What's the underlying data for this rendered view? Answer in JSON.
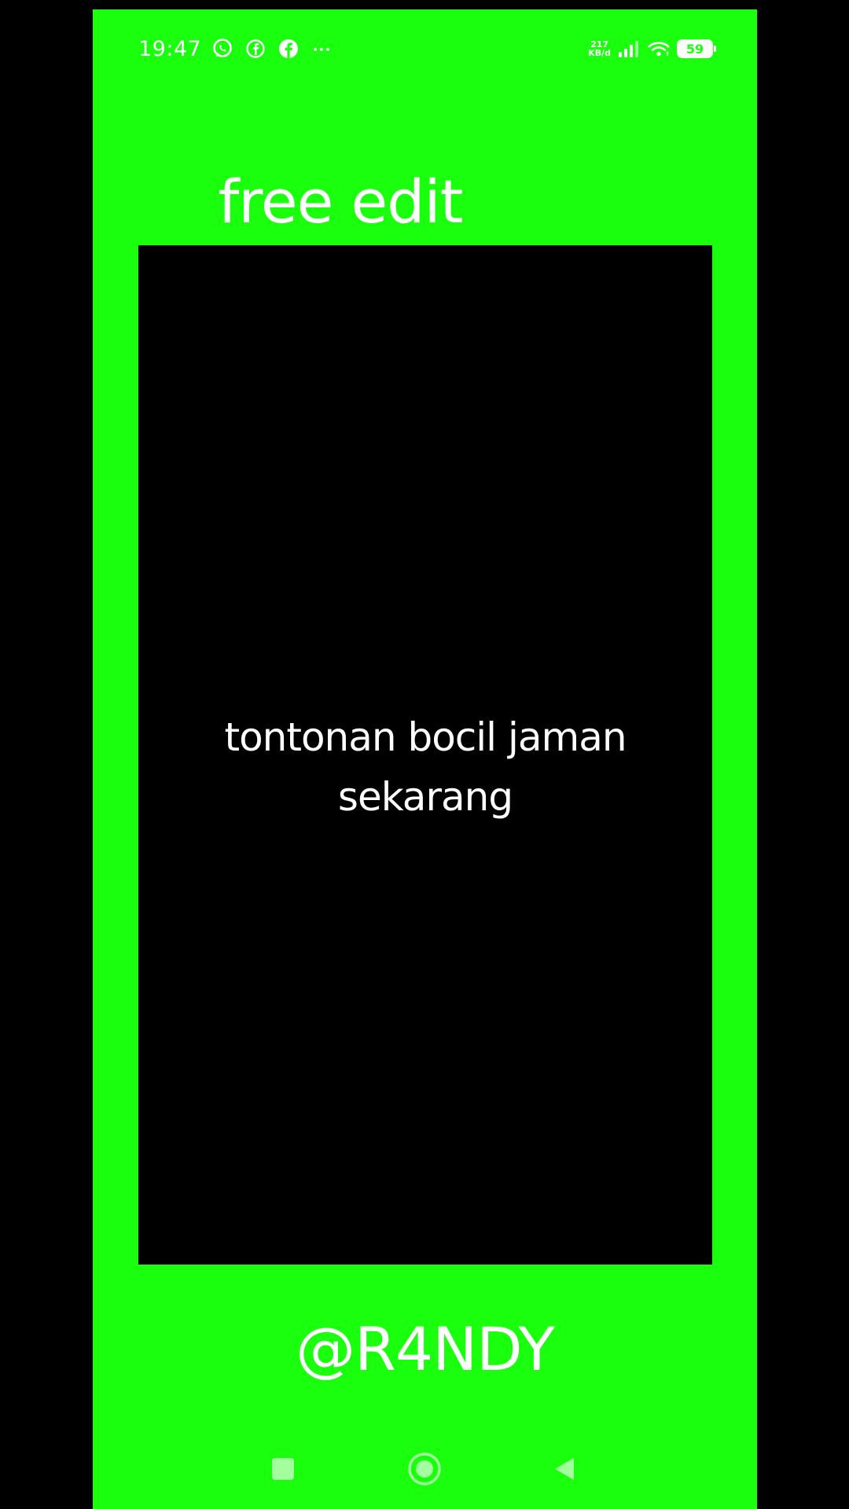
{
  "status_bar": {
    "time": "19:47",
    "left_icons": [
      "whatsapp-icon",
      "facebook-lite-icon",
      "facebook-icon",
      "more-notifications-icon"
    ],
    "more_glyph": "···",
    "net_speed_value": "217",
    "net_speed_unit": "KB/d",
    "battery_level": "59"
  },
  "header": {
    "title": "free edit"
  },
  "video": {
    "caption_line1": "tontonan bocil jaman",
    "caption_line2": "sekarang"
  },
  "footer": {
    "handle": "@R4NDY"
  },
  "nav_bar": {
    "buttons": [
      "recents-button",
      "home-button",
      "back-button"
    ]
  },
  "colors": {
    "background": "#1aff0d",
    "frame": "#000000",
    "text": "#ffffff"
  }
}
